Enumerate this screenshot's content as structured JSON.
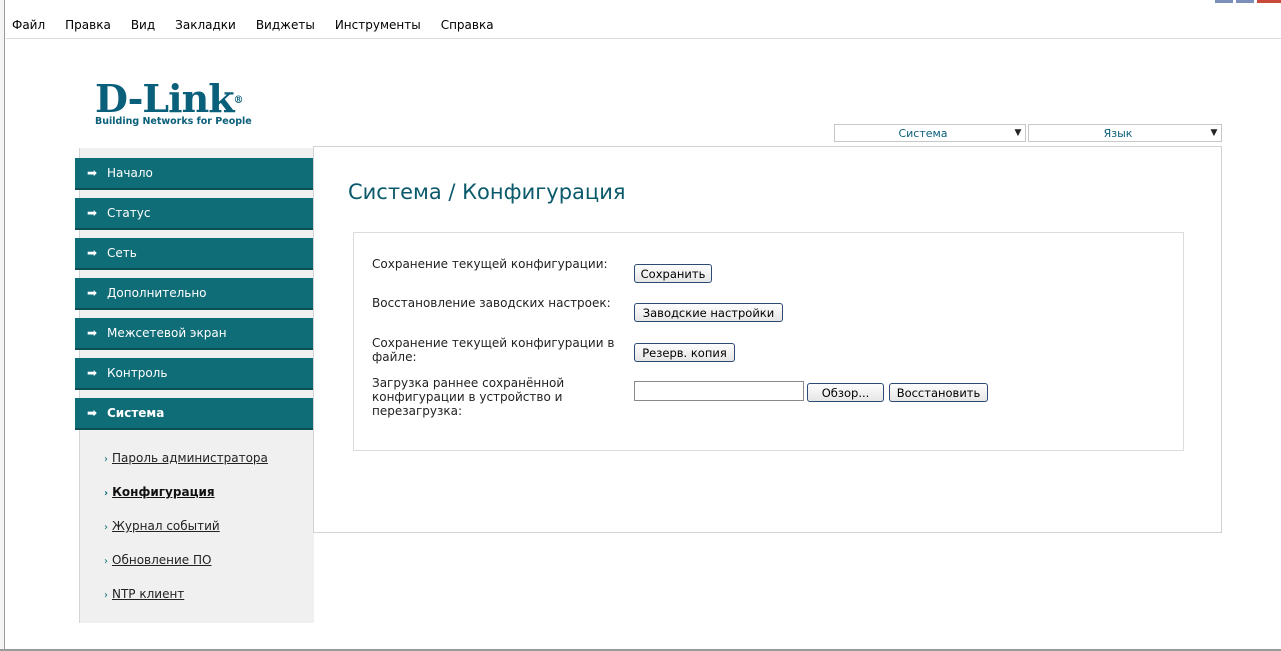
{
  "menu": [
    "Файл",
    "Правка",
    "Вид",
    "Закладки",
    "Виджеты",
    "Инструменты",
    "Справка"
  ],
  "logo": {
    "brand": "D-Link",
    "registered": "®",
    "tagline": "Building Networks for People"
  },
  "header": {
    "system_select": "Система",
    "language_select": "Язык"
  },
  "nav": [
    {
      "label": "Начало"
    },
    {
      "label": "Статус"
    },
    {
      "label": "Сеть"
    },
    {
      "label": "Дополнительно"
    },
    {
      "label": "Межсетевой экран"
    },
    {
      "label": "Контроль"
    },
    {
      "label": "Система"
    }
  ],
  "submenu": [
    {
      "label": "Пароль администратора"
    },
    {
      "label": "Конфигурация"
    },
    {
      "label": "Журнал событий"
    },
    {
      "label": "Обновление ПО"
    },
    {
      "label": "NTP клиент"
    }
  ],
  "page": {
    "title": "Система / Конфигурация",
    "rows": [
      {
        "label": "Сохранение текущей конфигурации:",
        "button": "Сохранить"
      },
      {
        "label": "Восстановление заводских настроек:",
        "button": "Заводские настройки"
      },
      {
        "label": "Сохранение текущей конфигурации в файле:",
        "button": "Резерв. копия"
      },
      {
        "label": "Загрузка раннее сохранённой конфигурации в устройство и перезагрузка:",
        "file_value": "",
        "browse_button": "Обзор...",
        "restore_button": "Восстановить"
      }
    ]
  },
  "colors": {
    "accent": "#0f6d78",
    "title": "#0b5a6b",
    "sidebar_bg": "#f0f0f0"
  }
}
